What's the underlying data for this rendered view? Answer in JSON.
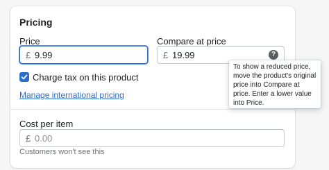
{
  "section": {
    "title": "Pricing"
  },
  "price": {
    "label": "Price",
    "currency": "£",
    "value": "9.99"
  },
  "compare_at_price": {
    "label": "Compare at price",
    "currency": "£",
    "value": "19.99",
    "help_icon": "question-circle-icon"
  },
  "tooltip": {
    "text": "To show a reduced price, move the product's original price into Compare at price. Enter a lower value into Price."
  },
  "charge_tax": {
    "label": "Charge tax on this product",
    "checked": true
  },
  "international_pricing": {
    "link_text": "Manage international pricing"
  },
  "cost_per_item": {
    "label": "Cost per item",
    "currency": "£",
    "placeholder": "0.00",
    "help_text": "Customers won't see this"
  },
  "colors": {
    "accent": "#2c6ecb",
    "text": "#202223",
    "subdued": "#6d7175"
  }
}
